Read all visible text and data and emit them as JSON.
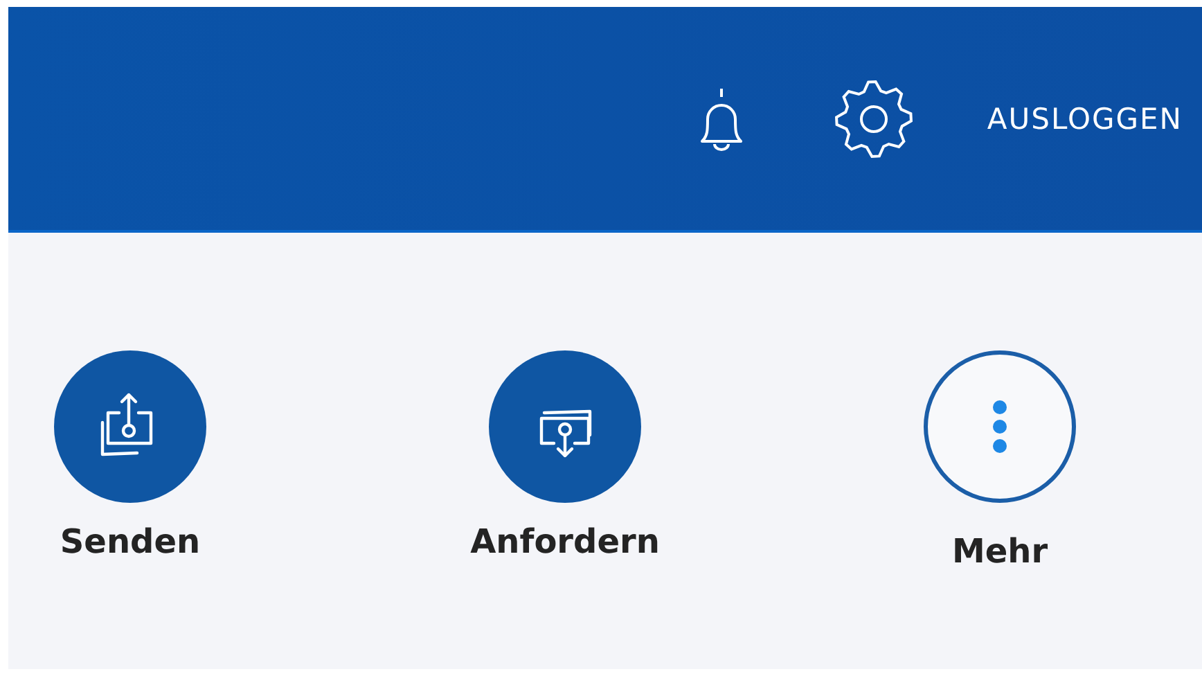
{
  "header": {
    "logout": "AUSLOGGEN"
  },
  "actions": [
    {
      "kind": "send",
      "label": "Senden"
    },
    {
      "kind": "request",
      "label": "Anfordern"
    },
    {
      "kind": "more",
      "label": "Mehr"
    }
  ]
}
